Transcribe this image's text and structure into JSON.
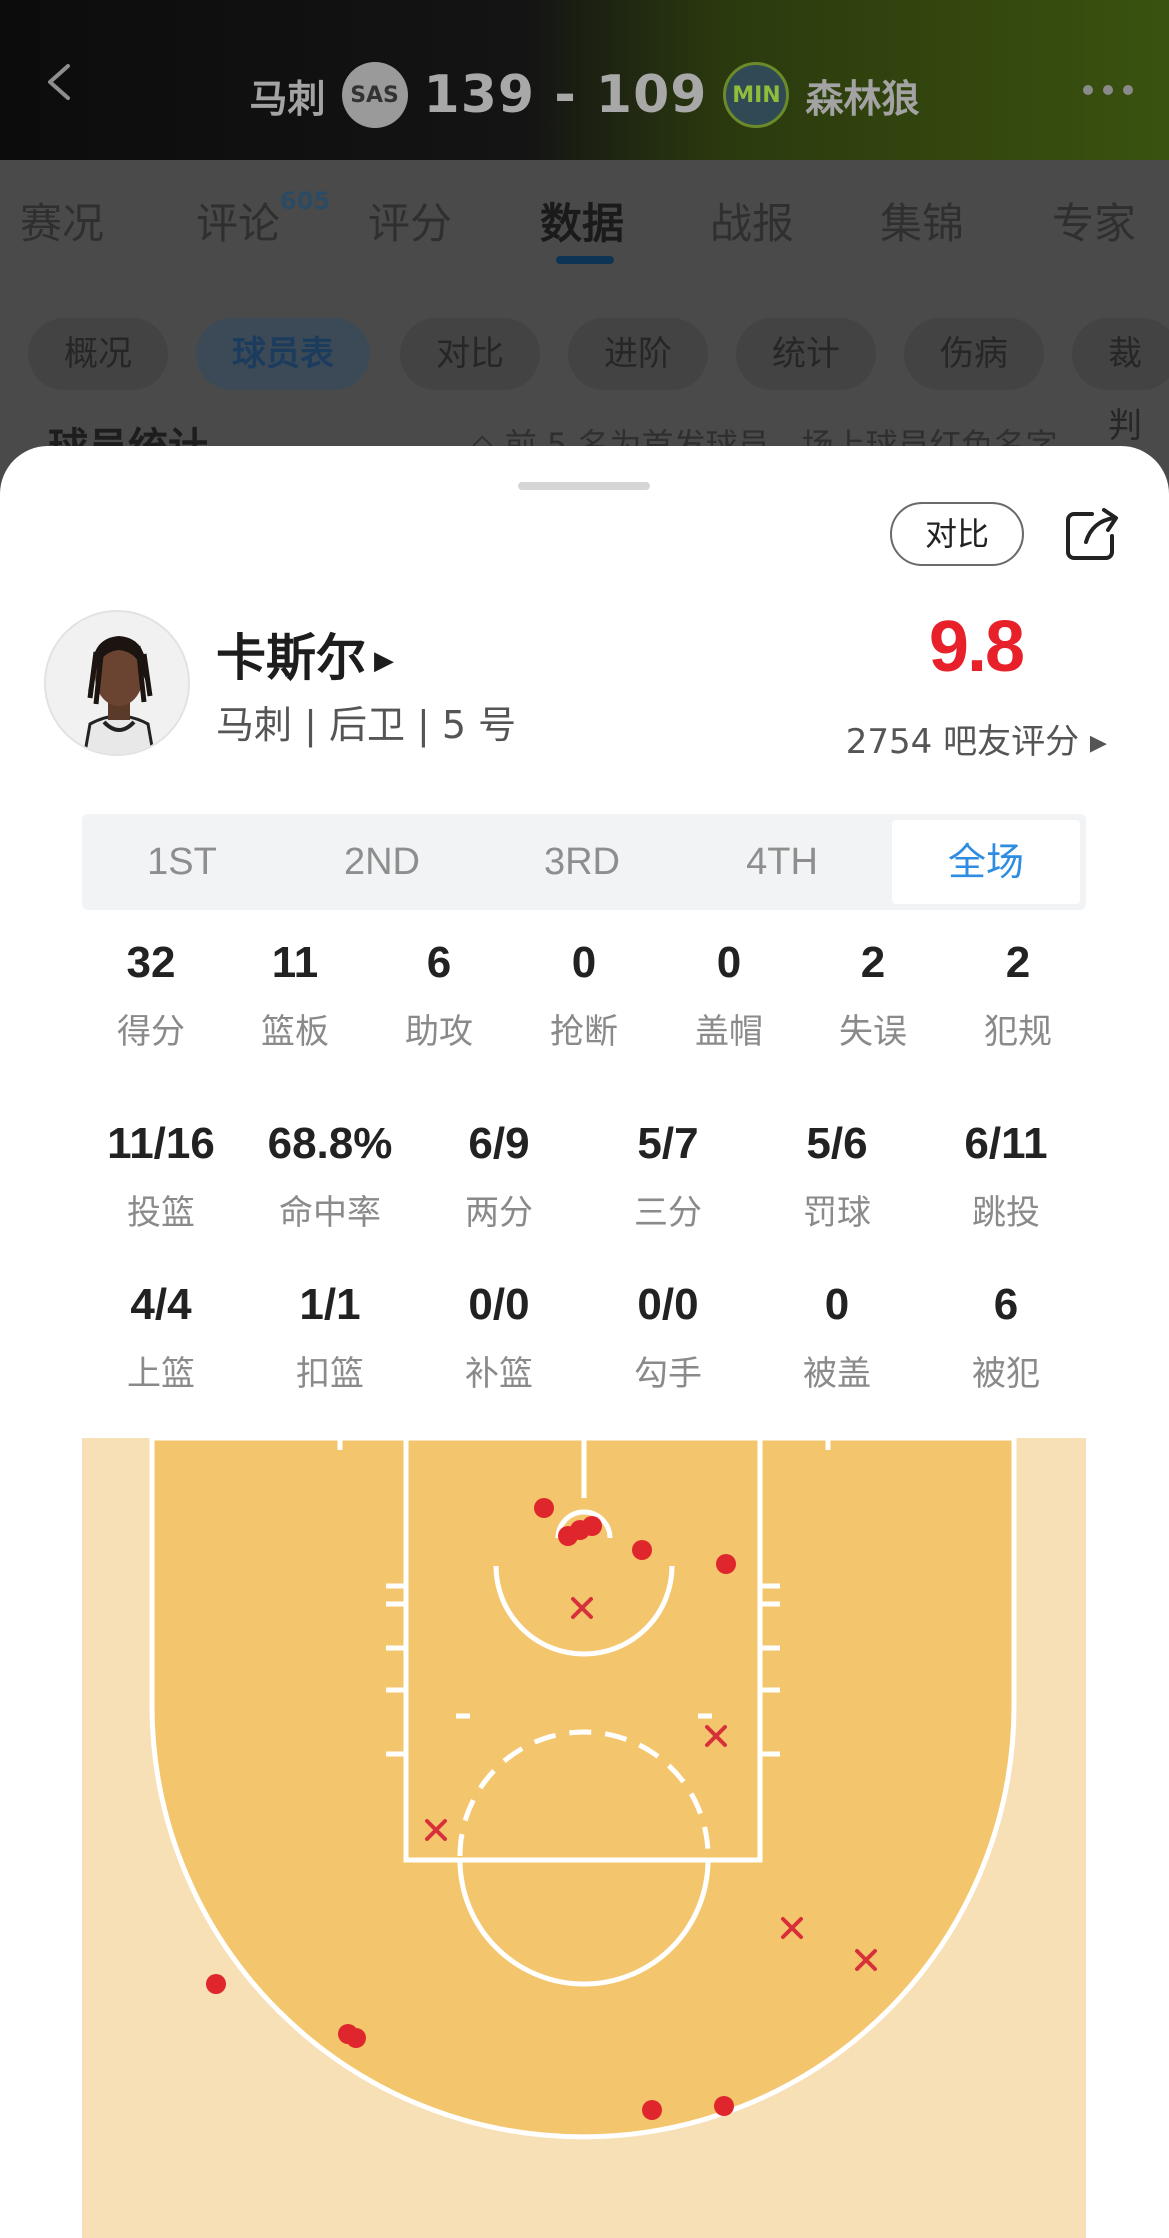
{
  "header": {
    "home_team": "马刺",
    "home_logo_text": "SAS",
    "score": "139 - 109",
    "away_logo_text": "MIN",
    "away_team": "森林狼"
  },
  "tabs": [
    {
      "label": "赛况"
    },
    {
      "label": "评论",
      "badge": "605"
    },
    {
      "label": "评分"
    },
    {
      "label": "数据",
      "active": true
    },
    {
      "label": "战报"
    },
    {
      "label": "集锦"
    },
    {
      "label": "专家"
    }
  ],
  "subtabs": [
    {
      "label": "概况"
    },
    {
      "label": "球员表",
      "active": true
    },
    {
      "label": "对比"
    },
    {
      "label": "进阶"
    },
    {
      "label": "统计"
    },
    {
      "label": "伤病"
    },
    {
      "label": "裁判"
    }
  ],
  "section": {
    "title_peek": "球员统计",
    "note_peek": "◇ 前 5 名为首发球员，场上球员红色名字"
  },
  "sheet": {
    "compare_label": "对比",
    "player": {
      "name": "卡斯尔",
      "meta": "马刺 | 后卫 | 5 号",
      "rating": "9.8",
      "rating_count": "2754 吧友评分 ▸"
    },
    "periods": [
      "1ST",
      "2ND",
      "3RD",
      "4TH",
      "全场"
    ],
    "active_period": "全场",
    "row1": [
      {
        "value": "32",
        "label": "得分"
      },
      {
        "value": "11",
        "label": "篮板"
      },
      {
        "value": "6",
        "label": "助攻"
      },
      {
        "value": "0",
        "label": "抢断"
      },
      {
        "value": "0",
        "label": "盖帽"
      },
      {
        "value": "2",
        "label": "失误"
      },
      {
        "value": "2",
        "label": "犯规"
      }
    ],
    "row2": [
      {
        "value": "11/16",
        "label": "投篮"
      },
      {
        "value": "68.8%",
        "label": "命中率"
      },
      {
        "value": "6/9",
        "label": "两分"
      },
      {
        "value": "5/7",
        "label": "三分"
      },
      {
        "value": "5/6",
        "label": "罚球"
      },
      {
        "value": "6/11",
        "label": "跳投"
      }
    ],
    "row3": [
      {
        "value": "4/4",
        "label": "上篮"
      },
      {
        "value": "1/1",
        "label": "扣篮"
      },
      {
        "value": "0/0",
        "label": "补篮"
      },
      {
        "value": "0/0",
        "label": "勾手"
      },
      {
        "value": "0",
        "label": "被盖"
      },
      {
        "value": "6",
        "label": "被犯"
      }
    ],
    "shot_chart": {
      "made_color": "#e0262d",
      "missed_color": "#d8303a",
      "made_count": 11,
      "missed_count": 5
    }
  },
  "colors": {
    "accent_blue": "#2e8de0",
    "rating_red": "#e8202a",
    "court_paint": "#f3c66e",
    "court_outer": "#f7dfb6"
  }
}
